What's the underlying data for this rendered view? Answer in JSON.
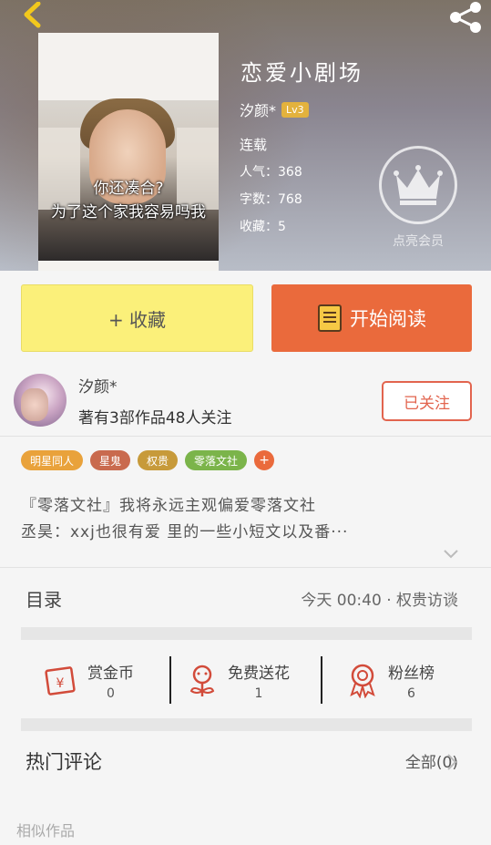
{
  "book": {
    "title": "恋爱小剧场",
    "author": "汐颜*",
    "level": "Lv3",
    "status": "连载",
    "popularity": "人气：368",
    "word_count": "字数：768",
    "favorites": "收藏：5",
    "cover_caption_line1": "你还凑合?",
    "cover_caption_line2": "为了这个家我容易吗我"
  },
  "vip": {
    "label": "点亮会员"
  },
  "actions": {
    "favorite": "+ 收藏",
    "read": "开始阅读"
  },
  "author_card": {
    "name": "汐颜*",
    "stats": "著有3部作品48人关注",
    "follow": "已关注"
  },
  "tags": [
    {
      "label": "明星同人",
      "color": "#e9a23b"
    },
    {
      "label": "星鬼",
      "color": "#c96a4e"
    },
    {
      "label": "权贵",
      "color": "#c79a3a"
    },
    {
      "label": "零落文社",
      "color": "#7bb44a"
    }
  ],
  "tag_add": "+",
  "description": {
    "line1": "『零落文社』我将永远主观偏爱零落文社",
    "line2": "丞昊：xxj也很有爱 里的一些小短文以及番···"
  },
  "toc": {
    "label": "目录",
    "latest": "今天 00:40 · 权贵访谈"
  },
  "stats": [
    {
      "label": "赏金币",
      "value": "0",
      "icon": "coin-envelope-icon"
    },
    {
      "label": "免费送花",
      "value": "1",
      "icon": "flower-icon"
    },
    {
      "label": "粉丝榜",
      "value": "6",
      "icon": "medal-icon"
    }
  ],
  "comments": {
    "label": "热门评论",
    "all": "全部(0)"
  },
  "similar": {
    "label": "相似作品"
  },
  "colors": {
    "accent_orange": "#ea6a3c",
    "fav_yellow": "#fbf07a",
    "follow_red": "#e2644e",
    "back_yellow": "#f2c81c"
  }
}
